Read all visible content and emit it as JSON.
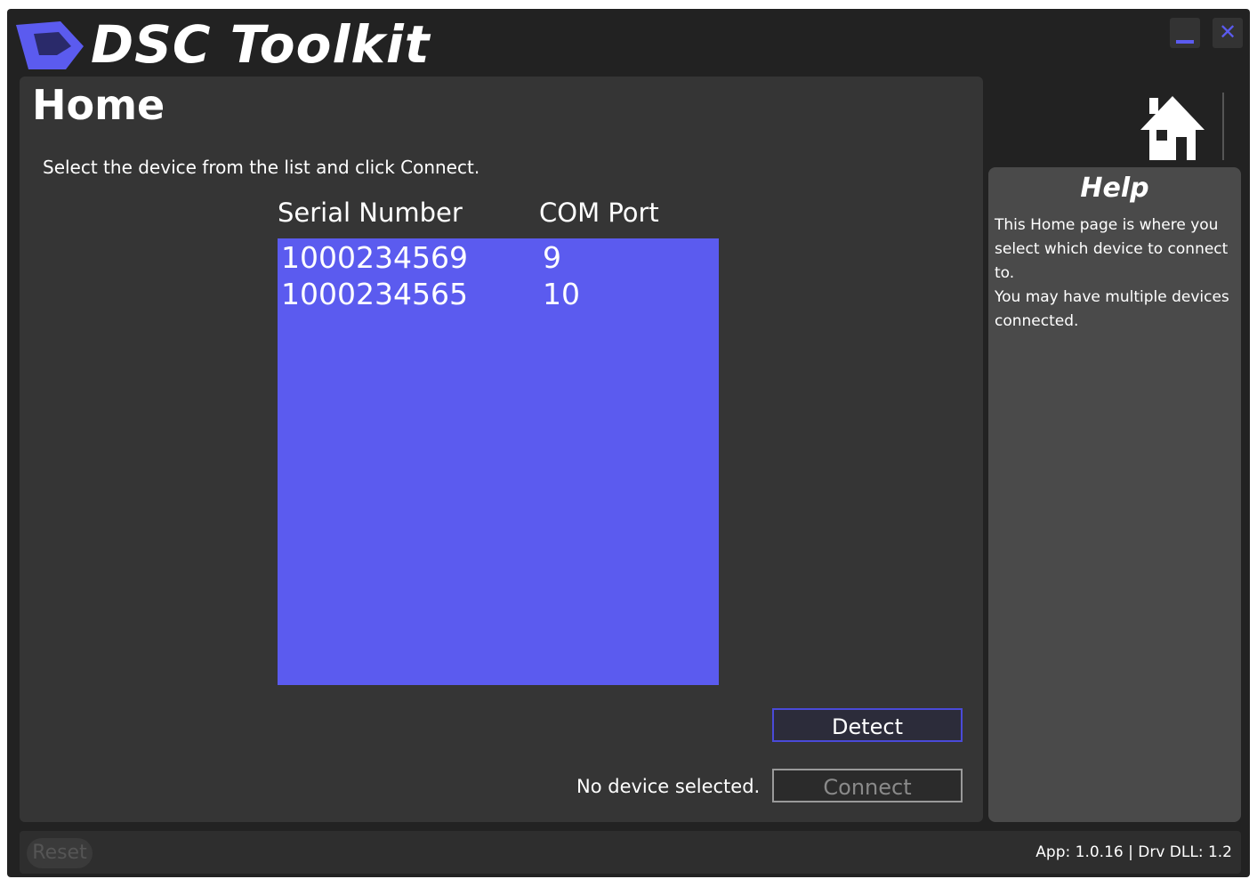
{
  "window": {
    "title": "DSC Toolkit",
    "minimize_icon": "minimize-icon",
    "close_icon": "close-icon",
    "close_glyph": "✕"
  },
  "colors": {
    "accent": "#5b5bef",
    "background": "#222222",
    "panel": "#353535",
    "help_panel": "#4a4a4a"
  },
  "page": {
    "title": "Home",
    "instruction": "Select the device from the list and click Connect.",
    "icon": "home-icon"
  },
  "device_table": {
    "headers": [
      "Serial Number",
      "COM Port"
    ],
    "rows": [
      {
        "serial": "1000234569",
        "port": "9"
      },
      {
        "serial": "1000234565",
        "port": "10"
      }
    ]
  },
  "actions": {
    "detect_label": "Detect",
    "connect_label": "Connect",
    "status": "No device selected."
  },
  "help": {
    "title": "Help",
    "paragraphs": [
      "This Home page is where you select which device to connect to.",
      "You may have multiple devices connected."
    ]
  },
  "footer": {
    "reset_label": "Reset",
    "version": "App: 1.0.16 | Drv DLL: 1.2"
  }
}
